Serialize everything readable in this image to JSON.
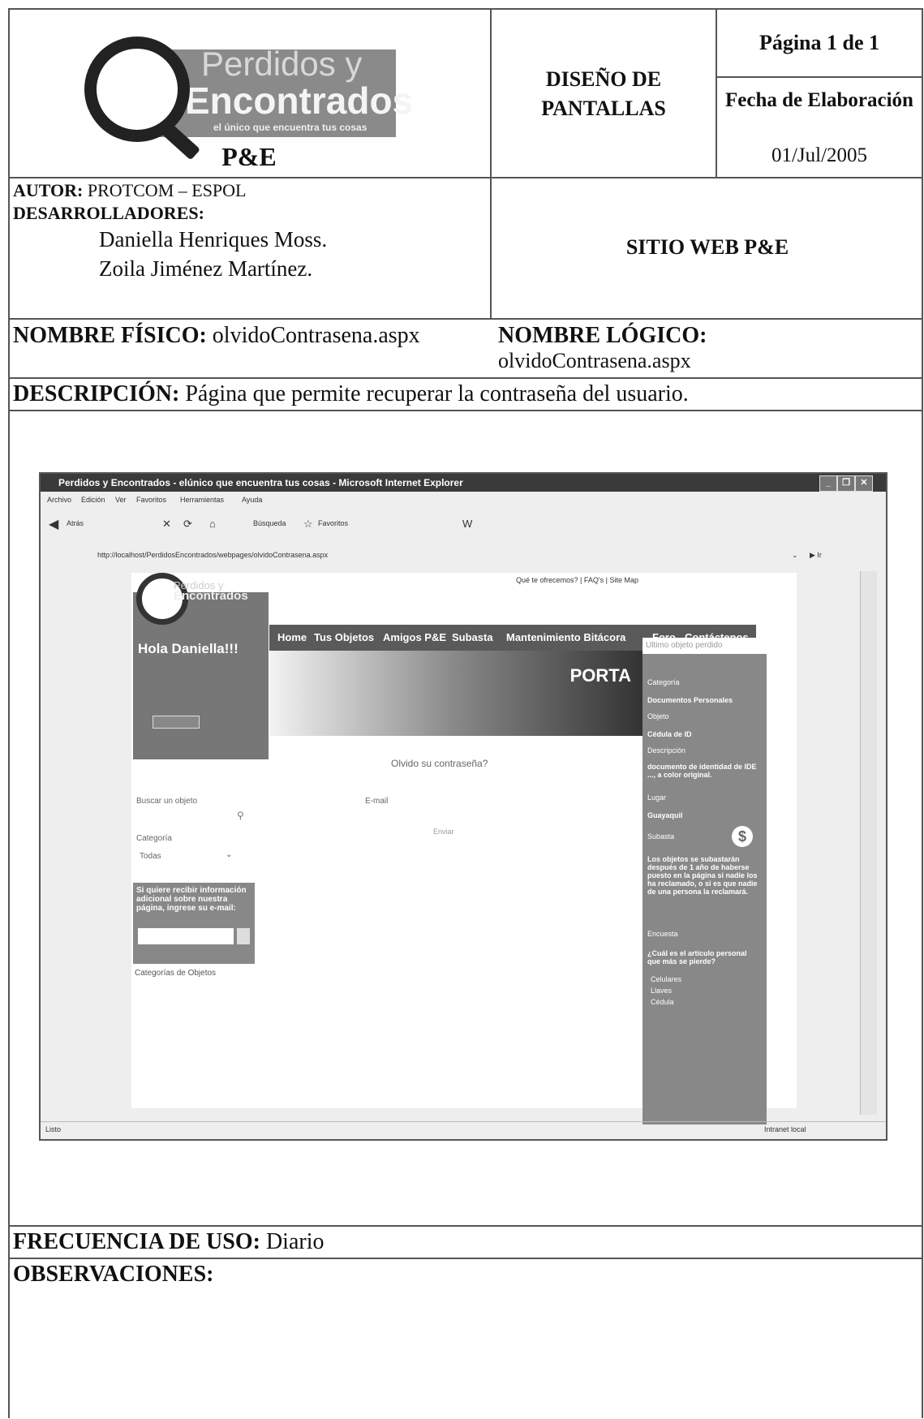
{
  "header": {
    "logo": {
      "line1": "Perdidos y",
      "line2": "Encontrados",
      "tagline": "el único que encuentra tus cosas"
    },
    "company": "P&E",
    "doc_type": "DISEÑO DE PANTALLAS",
    "page": "Página 1 de 1",
    "date_label": "Fecha de Elaboración",
    "date": "01/Jul/2005"
  },
  "meta": {
    "autor_label": "AUTOR:",
    "autor": "PROTCOM – ESPOL",
    "dev_label": "DESARROLLADORES:",
    "devs": [
      "Daniella Henriques Moss.",
      "Zoila Jiménez Martínez."
    ],
    "site": "SITIO WEB P&E",
    "fisico_label": "NOMBRE FÍSICO:",
    "fisico": "olvidoContrasena.aspx",
    "logico_label": "NOMBRE LÓGICO:",
    "logico": "olvidoContrasena.aspx",
    "desc_label": "DESCRIPCIÓN:",
    "desc": "Página que permite recuperar la contraseña del usuario.",
    "freq_label": "FRECUENCIA DE USO:",
    "freq": "Diario",
    "obs_label": "OBSERVACIONES:"
  },
  "screenshot": {
    "window_title": "Perdidos y Encontrados - elúnico que encuentra tus cosas - Microsoft Internet Explorer",
    "menu": [
      "Archivo",
      "Edición",
      "Ver",
      "Favoritos",
      "Herramientas",
      "Ayuda"
    ],
    "toolbar": {
      "back": "Atrás",
      "search": "Búsqueda",
      "favorites": "Favoritos"
    },
    "address": "http://localhost/PerdidosEncontrados/webpages/olvidoContrasena.aspx",
    "go": "Ir",
    "top_links": [
      "Qué te ofrecemos?",
      "FAQ's",
      "Site Map"
    ],
    "nav": [
      "Home",
      "Tus Objetos",
      "Amigos P&E",
      "Subasta",
      "Mantenimiento Bitácora",
      "Foro",
      "Contáctenos"
    ],
    "greeting": "Hola Daniella!!!",
    "hero_brand": "PORTA",
    "right_panel": [
      "Ultimo objeto perdido",
      "Categoría",
      "Documentos Personales",
      "Objeto",
      "Cédula de ID",
      "Descripción",
      "documento de identidad de IDE ..., a color original.",
      "Lugar",
      "Guayaquil",
      "Subasta",
      "Los objetos se subastarán después de 1 año de haberse puesto en la página si nadie los ha reclamado, o si es que nadie de una persona la reclamará.",
      "Encuesta",
      "¿Cuál es el artículo personal que más se pierde?",
      "Celulares",
      "Llaves",
      "Cédula"
    ],
    "form_title": "Olvido su contraseña?",
    "email_label": "E-mail",
    "send": "Enviar",
    "left_search": "Buscar un objeto",
    "left_category": "Categoría",
    "left_select": "Todas",
    "newsletter": "Si quiere recibir información adicional sobre nuestra página, ingrese su e-mail:",
    "categories": "Categorías de Objetos",
    "status_left": "Listo",
    "status_right": "Intranet local"
  }
}
